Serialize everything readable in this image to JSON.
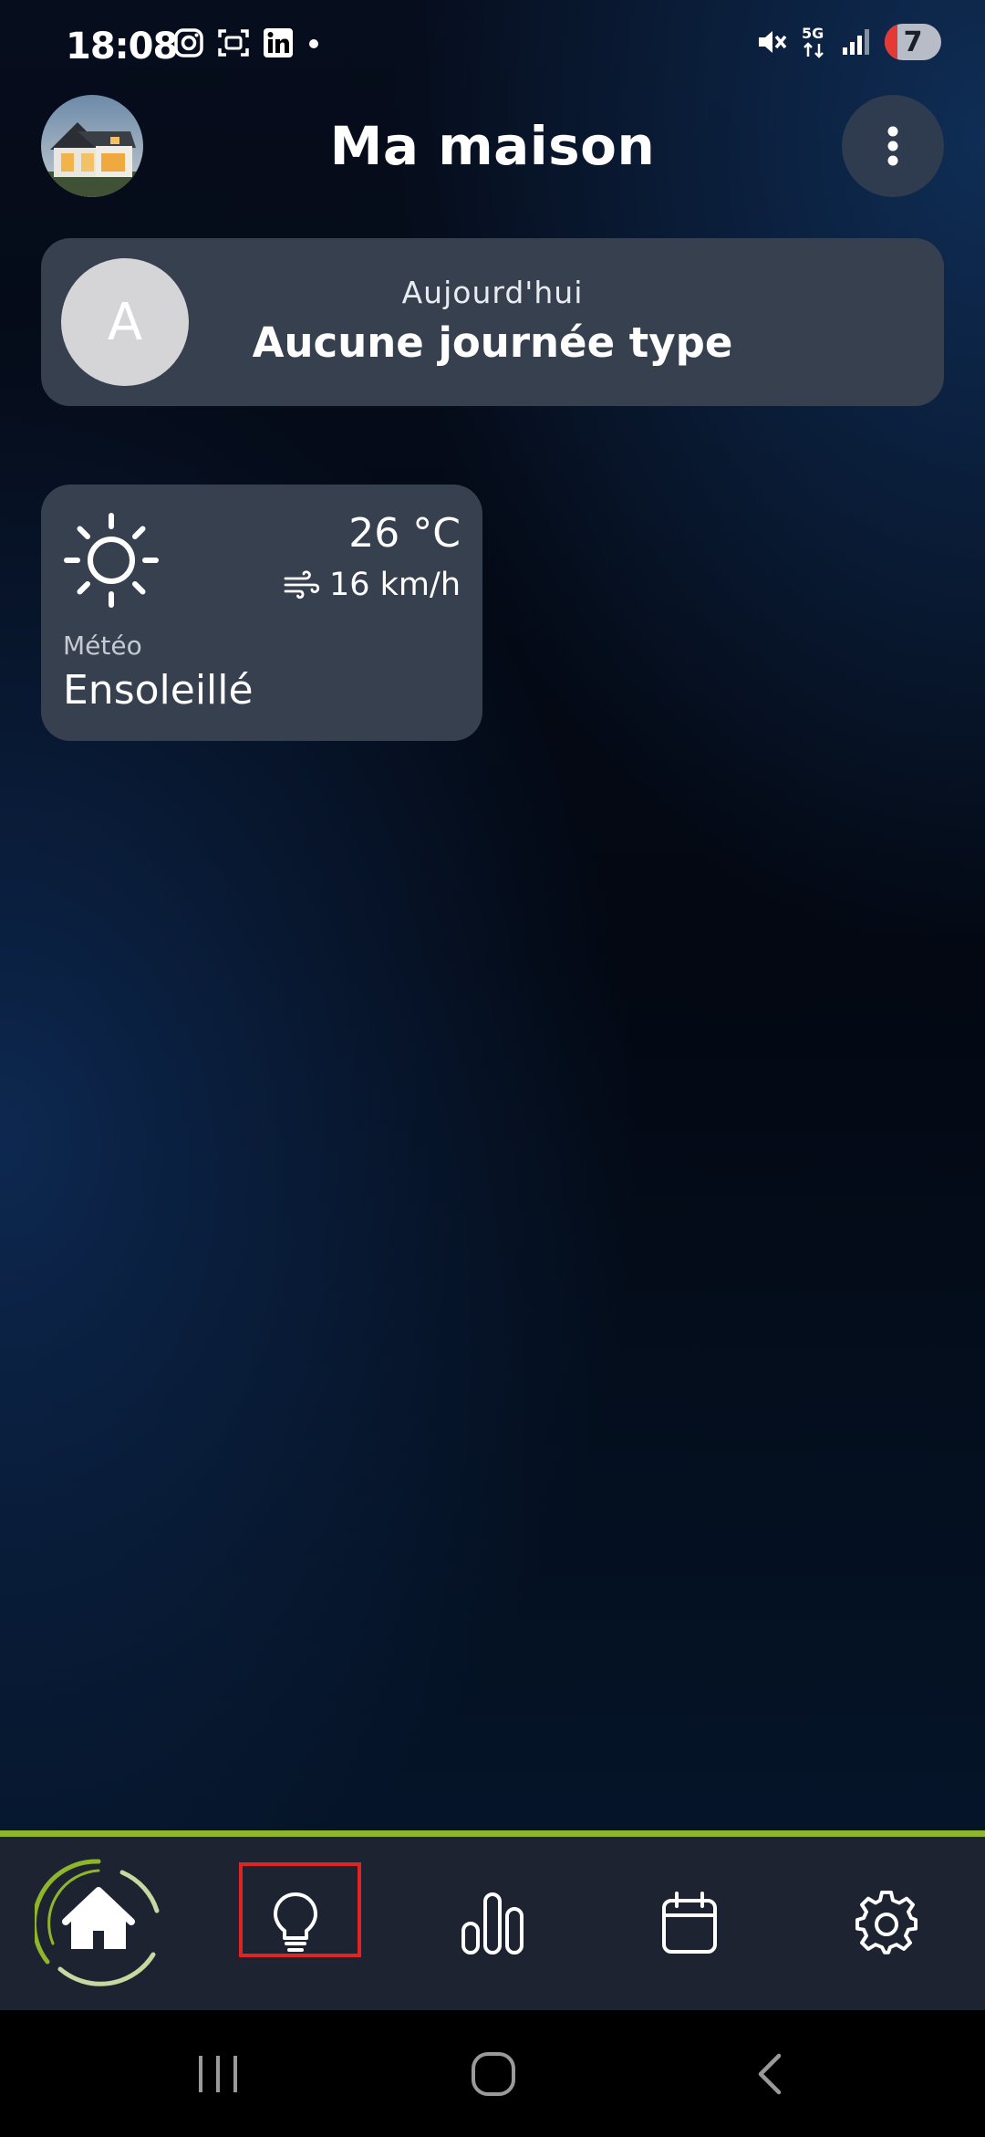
{
  "status_bar": {
    "time": "18:08",
    "left_icons": [
      "instagram-icon",
      "scan-icon",
      "linkedin-icon",
      "dot-icon"
    ],
    "right_icons": [
      "mute-icon",
      "5g-icon",
      "signal-icon"
    ],
    "battery_level": "7"
  },
  "header": {
    "title": "Ma maison",
    "avatar": "house-photo",
    "menu_icon": "more-vertical-icon"
  },
  "today_card": {
    "avatar_letter": "A",
    "label": "Aujourd'hui",
    "value": "Aucune journée type"
  },
  "weather_card": {
    "icon": "sun-icon",
    "temperature": "26 °C",
    "wind_icon": "wind-icon",
    "wind": "16 km/h",
    "label": "Météo",
    "condition": "Ensoleillé"
  },
  "bottom_nav": {
    "accent_color": "#8fb62a",
    "items": [
      {
        "name": "home",
        "icon": "home-icon",
        "active": true
      },
      {
        "name": "lighting",
        "icon": "lightbulb-icon",
        "highlighted": true
      },
      {
        "name": "statistics",
        "icon": "bar-chart-icon"
      },
      {
        "name": "calendar",
        "icon": "calendar-icon"
      },
      {
        "name": "settings",
        "icon": "gear-icon"
      }
    ]
  },
  "android_nav": {
    "items": [
      "recents-icon",
      "home-circle-icon",
      "back-icon"
    ]
  }
}
